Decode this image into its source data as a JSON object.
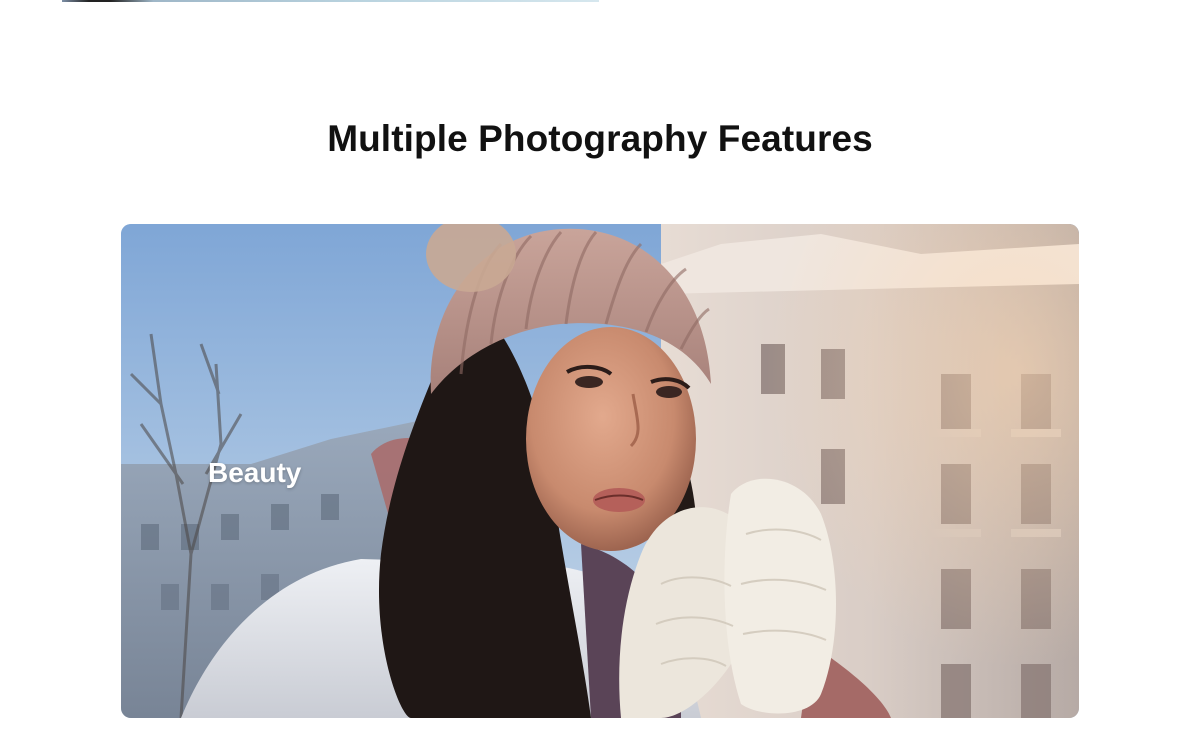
{
  "section": {
    "title": "Multiple Photography Features"
  },
  "feature_card": {
    "label": "Beauty",
    "image_description_icon": "woman-winter-portrait-photo"
  },
  "colors": {
    "title_text": "#111111",
    "label_text": "#ffffff",
    "page_background": "#ffffff"
  }
}
